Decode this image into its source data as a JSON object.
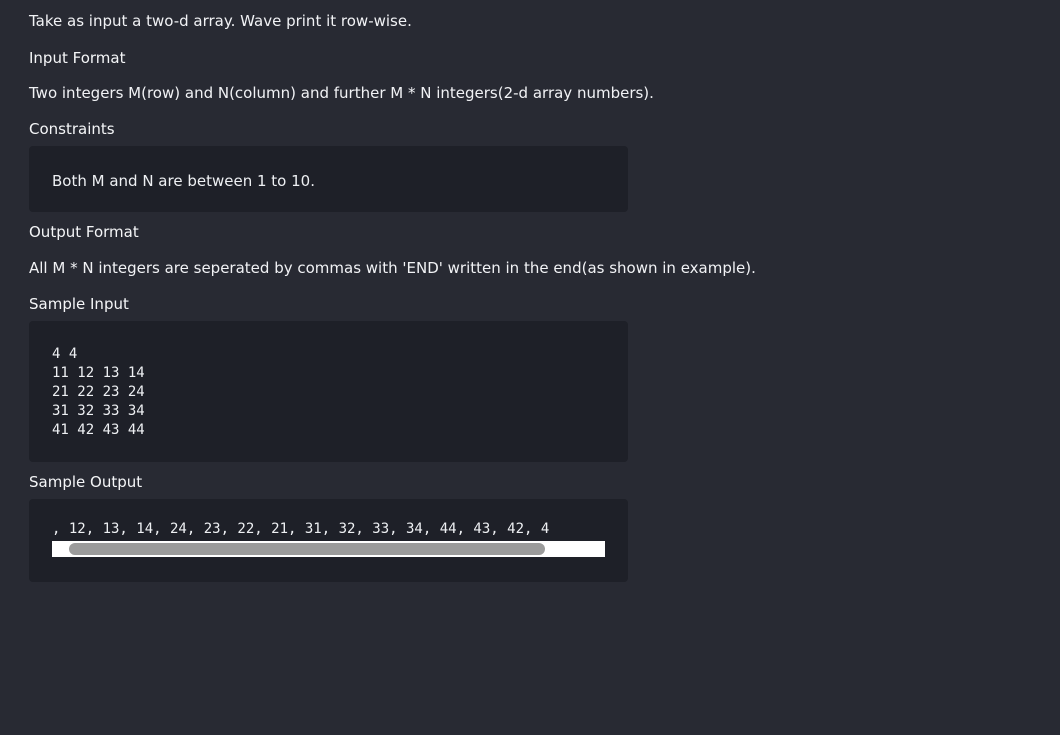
{
  "problem": {
    "statement": "Take as input a two-d array. Wave print it row-wise.",
    "input_format_heading": "Input Format",
    "input_format": "Two integers M(row) and N(column) and further M * N integers(2-d array numbers).",
    "constraints_heading": "Constraints",
    "constraints": "Both M and N are between 1 to 10.",
    "output_format_heading": "Output Format",
    "output_format": "All M * N integers are seperated by commas with 'END' written in the end(as shown in example).",
    "sample_input_heading": "Sample Input",
    "sample_input": "4 4\n11 12 13 14\n21 22 23 24\n31 32 33 34\n41 42 43 44",
    "sample_output_heading": "Sample Output",
    "sample_output_visible": ", 12, 13, 14, 24, 23, 22, 21, 31, 32, 33, 34, 44, 43, 42, 4"
  }
}
